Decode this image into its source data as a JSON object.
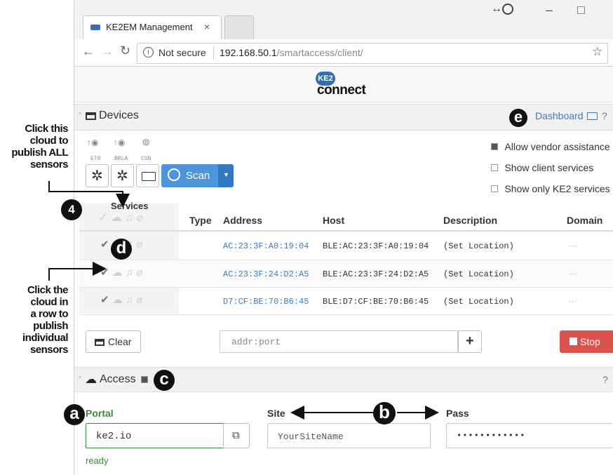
{
  "browser": {
    "tab_title": "KE2EM Management",
    "tab_close": "×",
    "not_secure": "Not secure",
    "url_host": "192.168.50.1",
    "url_path": "/smartaccess/client/",
    "min_glyph": "–",
    "max_glyph": "□"
  },
  "logo": {
    "top": "KE2",
    "bottom": "connect"
  },
  "devices": {
    "title": "Devices",
    "dashboard": "Dashboard",
    "help": "?",
    "sensor_labels": [
      "ET0",
      "BRLA",
      "CSN"
    ],
    "scan_label": "Scan",
    "options": [
      {
        "label": "Allow vendor assistance",
        "checked": true
      },
      {
        "label": "Show client services",
        "checked": false
      },
      {
        "label": "Show only KE2 services",
        "checked": false
      }
    ],
    "columns": {
      "services": "Services",
      "type": "Type",
      "address": "Address",
      "host": "Host",
      "description": "Description",
      "domain": "Domain"
    },
    "rows": [
      {
        "address": "AC:23:3F:A0:19:04",
        "host": "BLE:AC:23:3F:A0:19:04",
        "description": "(Set Location)",
        "domain": "···"
      },
      {
        "address": "AC:23:3F:24:D2:A5",
        "host": "BLE:AC:23:3F:24:D2:A5",
        "description": "(Set Location)",
        "domain": "···"
      },
      {
        "address": "D7:CF:BE:70:B6:45",
        "host": "BLE:D7:CF:BE:70:B6:45",
        "description": "(Set Location)",
        "domain": "···"
      }
    ],
    "clear_label": "Clear",
    "addr_placeholder": "addr:port",
    "plus": "+",
    "stop_label": "Stop"
  },
  "access": {
    "title": "Access",
    "help": "?",
    "portal_label": "Portal",
    "portal_value": "ke2.io",
    "site_label": "Site",
    "site_value": "YourSiteName",
    "pass_label": "Pass",
    "pass_value": "••••••••••••",
    "status": "ready"
  },
  "annotations": {
    "publish_all": [
      "Click this",
      "cloud to",
      "publish ALL",
      "sensors"
    ],
    "publish_individual": [
      "Click the",
      "cloud  in",
      "a row to",
      "publish",
      "individual",
      "sensors"
    ],
    "markers": {
      "m4": "4",
      "a": "a",
      "b": "b",
      "c": "c",
      "d": "d",
      "e": "e"
    }
  },
  "colors": {
    "accent": "#3a7dbf",
    "stop": "#d9534f",
    "portal_green": "#3c8a3c",
    "mac_blue": "#3a7dbf"
  }
}
